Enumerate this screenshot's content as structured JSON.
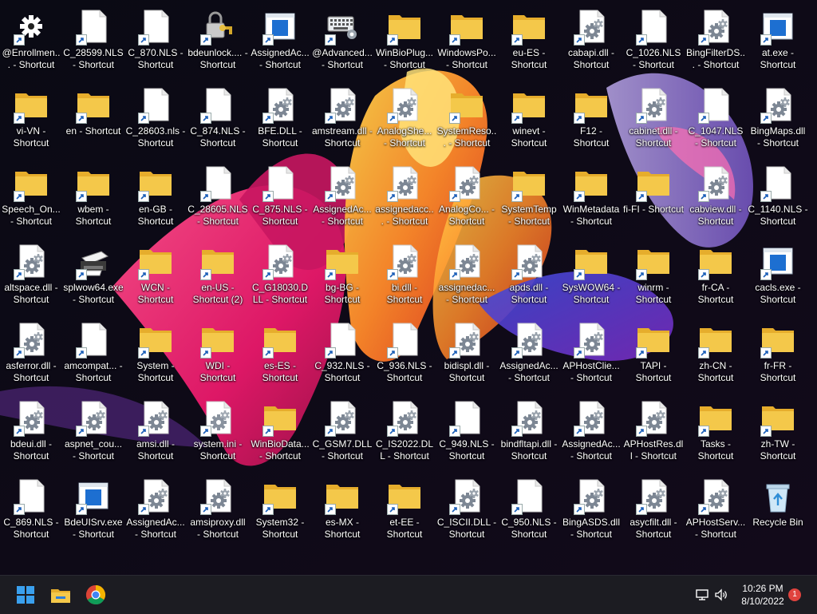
{
  "desktop": {
    "columns": 13,
    "icons": [
      {
        "label": "@Enrollmen... - Shortcut",
        "type": "gear",
        "shortcut": true
      },
      {
        "label": "C_28599.NLS - Shortcut",
        "type": "file",
        "shortcut": true
      },
      {
        "label": "C_870.NLS - Shortcut",
        "type": "file",
        "shortcut": true
      },
      {
        "label": "bdeunlock.... - Shortcut",
        "type": "lock",
        "shortcut": true
      },
      {
        "label": "AssignedAc... - Shortcut",
        "type": "window",
        "shortcut": true
      },
      {
        "label": "@Advanced... - Shortcut",
        "type": "keyboard",
        "shortcut": true
      },
      {
        "label": "WinBioPlug... - Shortcut",
        "type": "folder",
        "shortcut": true
      },
      {
        "label": "WindowsPo... - Shortcut",
        "type": "folder",
        "shortcut": true
      },
      {
        "label": "eu-ES - Shortcut",
        "type": "folder",
        "shortcut": true
      },
      {
        "label": "cabapi.dll - Shortcut",
        "type": "dll",
        "shortcut": true
      },
      {
        "label": "C_1026.NLS - Shortcut",
        "type": "file",
        "shortcut": true
      },
      {
        "label": "BingFilterDS... - Shortcut",
        "type": "dll",
        "shortcut": true
      },
      {
        "label": "at.exe - Shortcut",
        "type": "window",
        "shortcut": true
      },
      {
        "label": "vi-VN - Shortcut",
        "type": "folder",
        "shortcut": true
      },
      {
        "label": "en - Shortcut",
        "type": "folder",
        "shortcut": true
      },
      {
        "label": "C_28603.nls - Shortcut",
        "type": "file",
        "shortcut": true
      },
      {
        "label": "C_874.NLS - Shortcut",
        "type": "file",
        "shortcut": true
      },
      {
        "label": "BFE.DLL - Shortcut",
        "type": "dll",
        "shortcut": true
      },
      {
        "label": "amstream.dll - Shortcut",
        "type": "dll",
        "shortcut": true
      },
      {
        "label": "AnalogShe... - Shortcut",
        "type": "dll",
        "shortcut": true
      },
      {
        "label": "SystemReso... - Shortcut",
        "type": "folder",
        "shortcut": true
      },
      {
        "label": "winevt - Shortcut",
        "type": "folder",
        "shortcut": true
      },
      {
        "label": "F12 - Shortcut",
        "type": "folder",
        "shortcut": true
      },
      {
        "label": "cabinet.dll - Shortcut",
        "type": "dll",
        "shortcut": true
      },
      {
        "label": "C_1047.NLS - Shortcut",
        "type": "file",
        "shortcut": true
      },
      {
        "label": "BingMaps.dll - Shortcut",
        "type": "dll",
        "shortcut": true
      },
      {
        "label": "Speech_On... - Shortcut",
        "type": "folder",
        "shortcut": true
      },
      {
        "label": "wbem - Shortcut",
        "type": "folder",
        "shortcut": true
      },
      {
        "label": "en-GB - Shortcut",
        "type": "folder",
        "shortcut": true
      },
      {
        "label": "C_28605.NLS - Shortcut",
        "type": "file",
        "shortcut": true
      },
      {
        "label": "C_875.NLS - Shortcut",
        "type": "file",
        "shortcut": true
      },
      {
        "label": "AssignedAc... - Shortcut",
        "type": "dll",
        "shortcut": true
      },
      {
        "label": "assignedacc... - Shortcut",
        "type": "dll",
        "shortcut": true
      },
      {
        "label": "AnalogCo... - Shortcut",
        "type": "dll",
        "shortcut": true
      },
      {
        "label": "SystemTemp - Shortcut",
        "type": "folder",
        "shortcut": true
      },
      {
        "label": "WinMetadata - Shortcut",
        "type": "folder",
        "shortcut": true
      },
      {
        "label": "fi-FI - Shortcut",
        "type": "folder",
        "shortcut": true
      },
      {
        "label": "cabview.dll - Shortcut",
        "type": "dll",
        "shortcut": true
      },
      {
        "label": "C_1140.NLS - Shortcut",
        "type": "file",
        "shortcut": true
      },
      {
        "label": "altspace.dll - Shortcut",
        "type": "dll",
        "shortcut": true
      },
      {
        "label": "splwow64.exe - Shortcut",
        "type": "printer",
        "shortcut": true
      },
      {
        "label": "WCN - Shortcut",
        "type": "folder",
        "shortcut": true
      },
      {
        "label": "en-US - Shortcut (2)",
        "type": "folder",
        "shortcut": true
      },
      {
        "label": "C_G18030.DLL - Shortcut",
        "type": "dll",
        "shortcut": true
      },
      {
        "label": "bg-BG - Shortcut",
        "type": "folder",
        "shortcut": true
      },
      {
        "label": "bi.dll - Shortcut",
        "type": "dll",
        "shortcut": true
      },
      {
        "label": "assignedac... - Shortcut",
        "type": "dll",
        "shortcut": true
      },
      {
        "label": "apds.dll - Shortcut",
        "type": "dll",
        "shortcut": true
      },
      {
        "label": "SysWOW64 - Shortcut",
        "type": "folder",
        "shortcut": true
      },
      {
        "label": "winrm - Shortcut",
        "type": "folder",
        "shortcut": true
      },
      {
        "label": "fr-CA - Shortcut",
        "type": "folder",
        "shortcut": true
      },
      {
        "label": "cacls.exe - Shortcut",
        "type": "window",
        "shortcut": true
      },
      {
        "label": "asferror.dll - Shortcut",
        "type": "dll",
        "shortcut": true
      },
      {
        "label": "amcompat... - Shortcut",
        "type": "file",
        "shortcut": true
      },
      {
        "label": "System - Shortcut",
        "type": "folder",
        "shortcut": true
      },
      {
        "label": "WDI - Shortcut",
        "type": "folder",
        "shortcut": true
      },
      {
        "label": "es-ES - Shortcut",
        "type": "folder",
        "shortcut": true
      },
      {
        "label": "C_932.NLS - Shortcut",
        "type": "file",
        "shortcut": true
      },
      {
        "label": "C_936.NLS - Shortcut",
        "type": "file",
        "shortcut": true
      },
      {
        "label": "bidispl.dll - Shortcut",
        "type": "dll",
        "shortcut": true
      },
      {
        "label": "AssignedAc... - Shortcut",
        "type": "dll",
        "shortcut": true
      },
      {
        "label": "APHostClie... - Shortcut",
        "type": "dll",
        "shortcut": true
      },
      {
        "label": "TAPI - Shortcut",
        "type": "folder",
        "shortcut": true
      },
      {
        "label": "zh-CN - Shortcut",
        "type": "folder",
        "shortcut": true
      },
      {
        "label": "fr-FR - Shortcut",
        "type": "folder",
        "shortcut": true
      },
      {
        "label": "bdeui.dll - Shortcut",
        "type": "dll",
        "shortcut": true
      },
      {
        "label": "aspnet_cou... - Shortcut",
        "type": "dll",
        "shortcut": true
      },
      {
        "label": "amsi.dll - Shortcut",
        "type": "dll",
        "shortcut": true
      },
      {
        "label": "system.ini - Shortcut",
        "type": "ini",
        "shortcut": true
      },
      {
        "label": "WinBioData... - Shortcut",
        "type": "folder",
        "shortcut": true
      },
      {
        "label": "C_GSM7.DLL - Shortcut",
        "type": "dll",
        "shortcut": true
      },
      {
        "label": "C_IS2022.DLL - Shortcut",
        "type": "dll",
        "shortcut": true
      },
      {
        "label": "C_949.NLS - Shortcut",
        "type": "file",
        "shortcut": true
      },
      {
        "label": "bindfltapi.dll - Shortcut",
        "type": "dll",
        "shortcut": true
      },
      {
        "label": "AssignedAc... - Shortcut",
        "type": "dll",
        "shortcut": true
      },
      {
        "label": "APHostRes.dll - Shortcut",
        "type": "dll",
        "shortcut": true
      },
      {
        "label": "Tasks - Shortcut",
        "type": "folder",
        "shortcut": true
      },
      {
        "label": "zh-TW - Shortcut",
        "type": "folder",
        "shortcut": true
      },
      {
        "label": "C_869.NLS - Shortcut",
        "type": "file",
        "shortcut": true
      },
      {
        "label": "BdeUISrv.exe - Shortcut",
        "type": "window",
        "shortcut": true
      },
      {
        "label": "AssignedAc... - Shortcut",
        "type": "dll",
        "shortcut": true
      },
      {
        "label": "amsiproxy.dll - Shortcut",
        "type": "dll",
        "shortcut": true
      },
      {
        "label": "System32 - Shortcut",
        "type": "folder",
        "shortcut": true
      },
      {
        "label": "es-MX - Shortcut",
        "type": "folder",
        "shortcut": true
      },
      {
        "label": "et-EE - Shortcut",
        "type": "folder",
        "shortcut": true
      },
      {
        "label": "C_ISCII.DLL - Shortcut",
        "type": "dll",
        "shortcut": true
      },
      {
        "label": "C_950.NLS - Shortcut",
        "type": "file",
        "shortcut": true
      },
      {
        "label": "BingASDS.dll - Shortcut",
        "type": "dll",
        "shortcut": true
      },
      {
        "label": "asycfilt.dll - Shortcut",
        "type": "dll",
        "shortcut": true
      },
      {
        "label": "APHostServ... - Shortcut",
        "type": "dll",
        "shortcut": true
      },
      {
        "label": "Recycle Bin",
        "type": "recycle",
        "shortcut": false
      }
    ]
  },
  "taskbar": {
    "start_icon": "windows-start-icon",
    "pinned": [
      {
        "name": "file-explorer-icon"
      },
      {
        "name": "chrome-icon"
      }
    ],
    "tray": {
      "network_icon": "network-icon",
      "volume_icon": "volume-icon",
      "time": "10:26 PM",
      "date": "8/10/2022",
      "notification_count": "1"
    }
  },
  "colors": {
    "folder": "#f4c84a",
    "folder_tab": "#e6ad2c",
    "taskbar": "#1c1c22",
    "badge": "#e0433e",
    "start_blue": "#3aa0ee"
  }
}
